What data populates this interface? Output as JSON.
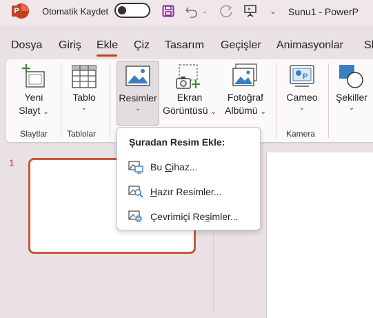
{
  "titlebar": {
    "autosave_label": "Otomatik Kaydet",
    "document_title": "Sunu1  -  PowerP",
    "brand_color": "#c43e1c"
  },
  "tabs": [
    "Dosya",
    "Giriş",
    "Ekle",
    "Çiz",
    "Tasarım",
    "Geçişler",
    "Animasyonlar",
    "Sl"
  ],
  "active_tab": "Ekle",
  "ribbon": {
    "yeni_slayt": [
      "Yeni",
      "Slayt"
    ],
    "tablo": "Tablo",
    "resimler": "Resimler",
    "ekran_goruntusu": [
      "Ekran",
      "Görüntüsü"
    ],
    "fotograf_albumu": [
      "Fotoğraf",
      "Albümü"
    ],
    "cameo": "Cameo",
    "sekiller": "Şekiller",
    "groups": {
      "slaytlar": "Slaytlar",
      "tablolar": "Tablolar",
      "kamera": "Kamera"
    }
  },
  "slide_pane": {
    "slide_number": "1"
  },
  "menu": {
    "title": "Şuradan Resim Ekle:",
    "items": [
      {
        "pre": "Bu ",
        "u": "C",
        "post": "ihaz...",
        "icon": "device-image-icon"
      },
      {
        "pre": "",
        "u": "H",
        "post": "azır Resimler...",
        "icon": "stock-images-icon"
      },
      {
        "pre": "Çevrimiçi Re",
        "u": "s",
        "post": "imler...",
        "icon": "online-images-icon"
      }
    ]
  }
}
